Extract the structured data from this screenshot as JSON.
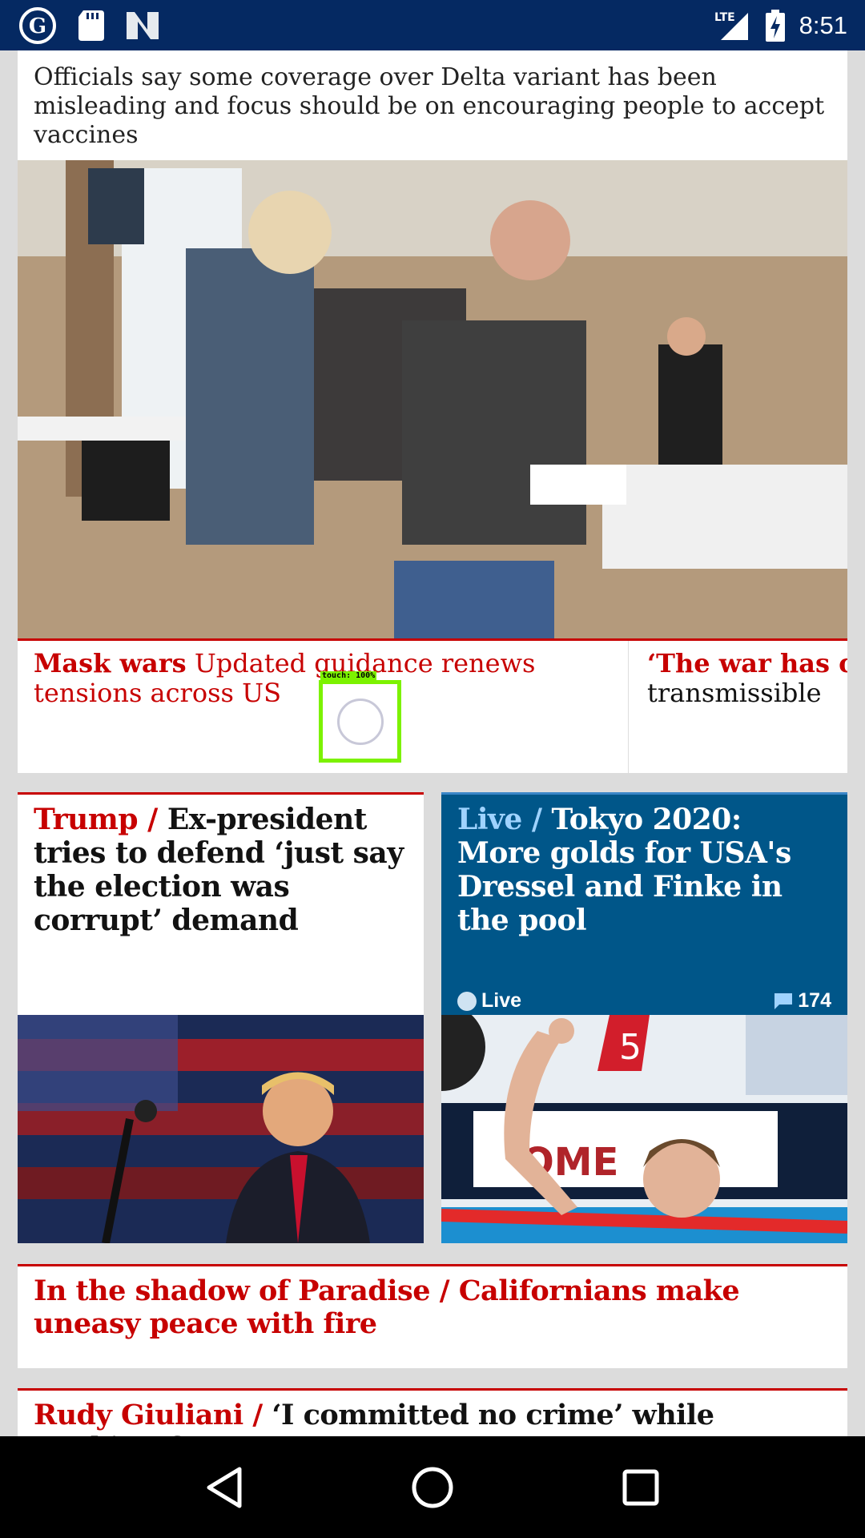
{
  "status_bar": {
    "time": "8:51",
    "network": "LTE",
    "left_icons": [
      "guardian-app-icon",
      "sd-card-icon",
      "news-app-icon"
    ],
    "right_icons": [
      "signal-icon",
      "battery-charging-icon"
    ]
  },
  "feed": {
    "top_story": {
      "standfirst": "Officials say some coverage over Delta variant has been misleading and focus should be on encouraging people to accept vaccines",
      "sublinks": [
        {
          "kicker": "Mask wars",
          "headline": "Updated guidance renews tensions across US"
        },
        {
          "kicker": "‘The war has chan",
          "headline": "transmissible"
        }
      ]
    },
    "trump_card": {
      "kicker": "Trump /",
      "headline": "Ex-president tries to defend ‘just say the election was corrupt’ demand"
    },
    "tokyo_card": {
      "kicker": "Live /",
      "headline": "Tokyo 2020: More golds for USA's Dressel and Finke in the pool",
      "live_label": "Live",
      "comment_count": "174"
    },
    "paradise_card": {
      "kicker": "In the shadow of Paradise /",
      "headline": "Californians make uneasy peace with fire"
    },
    "rudy_card": {
      "kicker": "Rudy Giuliani /",
      "headline": "‘I committed no crime’ while working for"
    }
  },
  "touch_indicator": {
    "label": "touch: 100%"
  },
  "nav_bar": {
    "buttons": [
      "back",
      "home",
      "recents"
    ]
  },
  "colors": {
    "status_bar": "#052962",
    "accent_red": "#c70000",
    "live_blue": "#005689"
  }
}
